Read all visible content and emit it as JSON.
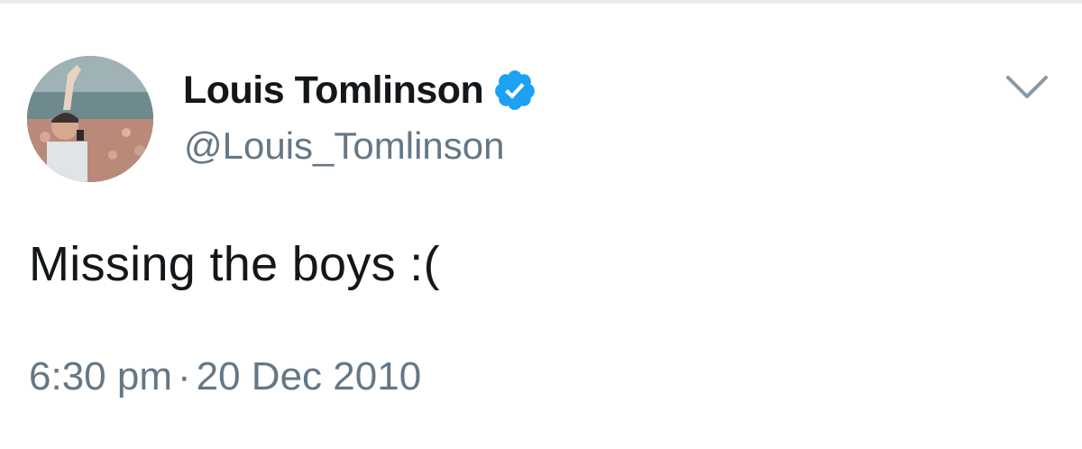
{
  "tweet": {
    "display_name": "Louis Tomlinson",
    "handle": "@Louis_Tomlinson",
    "verified": true,
    "text": "Missing the boys :(",
    "time": "6:30 pm",
    "separator": "·",
    "date": "20 Dec 2010"
  },
  "icons": {
    "verified": "verified-badge-icon",
    "menu": "chevron-down-icon"
  },
  "colors": {
    "verified_blue": "#1da1f2",
    "text_primary": "#14171a",
    "text_secondary": "#657786"
  }
}
